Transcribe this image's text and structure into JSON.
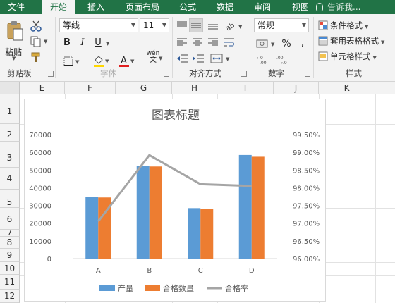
{
  "tabs": [
    {
      "label": "文件",
      "active": false
    },
    {
      "label": "开始",
      "active": true
    },
    {
      "label": "插入",
      "active": false
    },
    {
      "label": "页面布局",
      "active": false
    },
    {
      "label": "公式",
      "active": false
    },
    {
      "label": "数据",
      "active": false
    },
    {
      "label": "审阅",
      "active": false
    },
    {
      "label": "视图",
      "active": false
    }
  ],
  "tell_me": "告诉我...",
  "ribbon": {
    "paste_label": "粘贴",
    "font_name": "等线",
    "font_size": "11",
    "bold": "B",
    "italic": "I",
    "underline": "U",
    "pinyin": "wén",
    "number_format": "常规",
    "percent": "%",
    "comma": ",",
    "cond_format": "条件格式",
    "table_format": "套用表格格式",
    "cell_style": "单元格样式",
    "groups": {
      "clipboard": "剪贴板",
      "font": "字体",
      "alignment": "对齐方式",
      "number": "数字",
      "styles": "样式"
    }
  },
  "columns": [
    "E",
    "F",
    "G",
    "H",
    "I",
    "J",
    "K"
  ],
  "rows": [
    "1",
    "2",
    "3",
    "4",
    "5",
    "6",
    "7",
    "8",
    "9",
    "10",
    "11",
    "12"
  ],
  "colors": {
    "excel_green": "#217346",
    "bar1": "#5B9BD5",
    "bar2": "#ED7D31",
    "line": "#A5A5A5"
  },
  "chart_data": {
    "type": "bar",
    "title": "图表标题",
    "categories": [
      "A",
      "B",
      "C",
      "D"
    ],
    "series": [
      {
        "name": "产量",
        "type": "bar",
        "axis": "left",
        "values": [
          35000,
          52500,
          28500,
          58500
        ]
      },
      {
        "name": "合格数量",
        "type": "bar",
        "axis": "left",
        "values": [
          34500,
          52000,
          28000,
          57500
        ]
      },
      {
        "name": "合格率",
        "type": "line",
        "axis": "right",
        "values": [
          97.05,
          98.92,
          98.1,
          98.05
        ]
      }
    ],
    "ylim": [
      0,
      70000
    ],
    "y_ticks": [
      "0",
      "10000",
      "20000",
      "30000",
      "40000",
      "50000",
      "60000",
      "70000"
    ],
    "y2lim": [
      96.0,
      99.5
    ],
    "y2_ticks": [
      "96.00%",
      "96.50%",
      "97.00%",
      "97.50%",
      "98.00%",
      "98.50%",
      "99.00%",
      "99.50%"
    ],
    "grid": false,
    "legend_position": "bottom"
  }
}
